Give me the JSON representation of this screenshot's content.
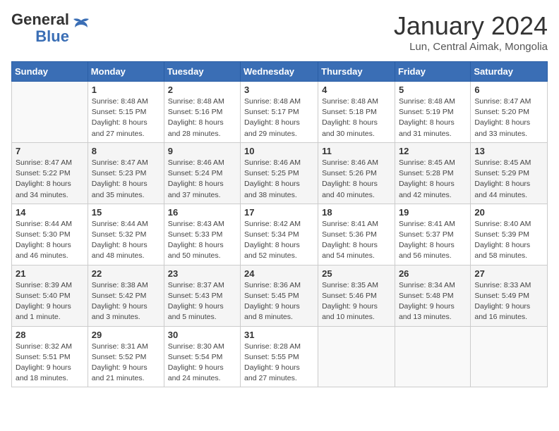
{
  "logo": {
    "line1": "General",
    "line2": "Blue"
  },
  "title": "January 2024",
  "subtitle": "Lun, Central Aimak, Mongolia",
  "days_of_week": [
    "Sunday",
    "Monday",
    "Tuesday",
    "Wednesday",
    "Thursday",
    "Friday",
    "Saturday"
  ],
  "weeks": [
    [
      {
        "day": "",
        "info": ""
      },
      {
        "day": "1",
        "info": "Sunrise: 8:48 AM\nSunset: 5:15 PM\nDaylight: 8 hours\nand 27 minutes."
      },
      {
        "day": "2",
        "info": "Sunrise: 8:48 AM\nSunset: 5:16 PM\nDaylight: 8 hours\nand 28 minutes."
      },
      {
        "day": "3",
        "info": "Sunrise: 8:48 AM\nSunset: 5:17 PM\nDaylight: 8 hours\nand 29 minutes."
      },
      {
        "day": "4",
        "info": "Sunrise: 8:48 AM\nSunset: 5:18 PM\nDaylight: 8 hours\nand 30 minutes."
      },
      {
        "day": "5",
        "info": "Sunrise: 8:48 AM\nSunset: 5:19 PM\nDaylight: 8 hours\nand 31 minutes."
      },
      {
        "day": "6",
        "info": "Sunrise: 8:47 AM\nSunset: 5:20 PM\nDaylight: 8 hours\nand 33 minutes."
      }
    ],
    [
      {
        "day": "7",
        "info": "Sunrise: 8:47 AM\nSunset: 5:22 PM\nDaylight: 8 hours\nand 34 minutes."
      },
      {
        "day": "8",
        "info": "Sunrise: 8:47 AM\nSunset: 5:23 PM\nDaylight: 8 hours\nand 35 minutes."
      },
      {
        "day": "9",
        "info": "Sunrise: 8:46 AM\nSunset: 5:24 PM\nDaylight: 8 hours\nand 37 minutes."
      },
      {
        "day": "10",
        "info": "Sunrise: 8:46 AM\nSunset: 5:25 PM\nDaylight: 8 hours\nand 38 minutes."
      },
      {
        "day": "11",
        "info": "Sunrise: 8:46 AM\nSunset: 5:26 PM\nDaylight: 8 hours\nand 40 minutes."
      },
      {
        "day": "12",
        "info": "Sunrise: 8:45 AM\nSunset: 5:28 PM\nDaylight: 8 hours\nand 42 minutes."
      },
      {
        "day": "13",
        "info": "Sunrise: 8:45 AM\nSunset: 5:29 PM\nDaylight: 8 hours\nand 44 minutes."
      }
    ],
    [
      {
        "day": "14",
        "info": "Sunrise: 8:44 AM\nSunset: 5:30 PM\nDaylight: 8 hours\nand 46 minutes."
      },
      {
        "day": "15",
        "info": "Sunrise: 8:44 AM\nSunset: 5:32 PM\nDaylight: 8 hours\nand 48 minutes."
      },
      {
        "day": "16",
        "info": "Sunrise: 8:43 AM\nSunset: 5:33 PM\nDaylight: 8 hours\nand 50 minutes."
      },
      {
        "day": "17",
        "info": "Sunrise: 8:42 AM\nSunset: 5:34 PM\nDaylight: 8 hours\nand 52 minutes."
      },
      {
        "day": "18",
        "info": "Sunrise: 8:41 AM\nSunset: 5:36 PM\nDaylight: 8 hours\nand 54 minutes."
      },
      {
        "day": "19",
        "info": "Sunrise: 8:41 AM\nSunset: 5:37 PM\nDaylight: 8 hours\nand 56 minutes."
      },
      {
        "day": "20",
        "info": "Sunrise: 8:40 AM\nSunset: 5:39 PM\nDaylight: 8 hours\nand 58 minutes."
      }
    ],
    [
      {
        "day": "21",
        "info": "Sunrise: 8:39 AM\nSunset: 5:40 PM\nDaylight: 9 hours\nand 1 minute."
      },
      {
        "day": "22",
        "info": "Sunrise: 8:38 AM\nSunset: 5:42 PM\nDaylight: 9 hours\nand 3 minutes."
      },
      {
        "day": "23",
        "info": "Sunrise: 8:37 AM\nSunset: 5:43 PM\nDaylight: 9 hours\nand 5 minutes."
      },
      {
        "day": "24",
        "info": "Sunrise: 8:36 AM\nSunset: 5:45 PM\nDaylight: 9 hours\nand 8 minutes."
      },
      {
        "day": "25",
        "info": "Sunrise: 8:35 AM\nSunset: 5:46 PM\nDaylight: 9 hours\nand 10 minutes."
      },
      {
        "day": "26",
        "info": "Sunrise: 8:34 AM\nSunset: 5:48 PM\nDaylight: 9 hours\nand 13 minutes."
      },
      {
        "day": "27",
        "info": "Sunrise: 8:33 AM\nSunset: 5:49 PM\nDaylight: 9 hours\nand 16 minutes."
      }
    ],
    [
      {
        "day": "28",
        "info": "Sunrise: 8:32 AM\nSunset: 5:51 PM\nDaylight: 9 hours\nand 18 minutes."
      },
      {
        "day": "29",
        "info": "Sunrise: 8:31 AM\nSunset: 5:52 PM\nDaylight: 9 hours\nand 21 minutes."
      },
      {
        "day": "30",
        "info": "Sunrise: 8:30 AM\nSunset: 5:54 PM\nDaylight: 9 hours\nand 24 minutes."
      },
      {
        "day": "31",
        "info": "Sunrise: 8:28 AM\nSunset: 5:55 PM\nDaylight: 9 hours\nand 27 minutes."
      },
      {
        "day": "",
        "info": ""
      },
      {
        "day": "",
        "info": ""
      },
      {
        "day": "",
        "info": ""
      }
    ]
  ]
}
